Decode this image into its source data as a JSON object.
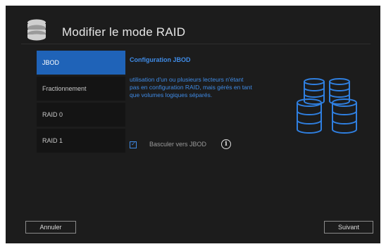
{
  "dialog": {
    "title": "Modifier le mode RAID",
    "icon": "database-icon"
  },
  "modes": [
    {
      "label": "JBOD",
      "selected": true
    },
    {
      "label": "Fractionnement",
      "selected": false
    },
    {
      "label": "RAID 0",
      "selected": false
    },
    {
      "label": "RAID 1",
      "selected": false
    }
  ],
  "config": {
    "title": "Configuration JBOD",
    "desc_lines": [
      "utilisation d'un ou plusieurs lecteurs n'étant",
      "pas en configuration RAID, mais gérés en tant",
      "que volumes logiques séparés."
    ],
    "illustration": "disk-cylinders-icon"
  },
  "checkbox": {
    "label": "Basculer vers JBOD",
    "checked": true,
    "info_icon": "info-icon"
  },
  "buttons": {
    "cancel": "Annuler",
    "next": "Suivant"
  },
  "colors": {
    "accent": "#1f63b8",
    "text_accent": "#3f8be6",
    "background": "#1c1c1c"
  }
}
